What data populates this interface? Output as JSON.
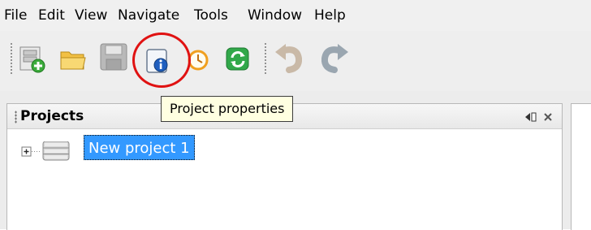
{
  "menubar": {
    "items": [
      "File",
      "Edit",
      "View",
      "Navigate",
      "Tools",
      "Window",
      "Help"
    ]
  },
  "toolbar": {
    "buttons": [
      {
        "icon": "new-project-icon",
        "enabled": true
      },
      {
        "icon": "open-folder-icon",
        "enabled": true
      },
      {
        "icon": "save-icon",
        "enabled": false
      },
      {
        "icon": "project-properties-icon",
        "enabled": true
      },
      {
        "icon": "clock-icon",
        "enabled": true
      },
      {
        "icon": "refresh-icon",
        "enabled": true
      },
      {
        "icon": "undo-icon",
        "enabled": false
      },
      {
        "icon": "redo-icon",
        "enabled": false
      }
    ],
    "highlight_color": "#e01212"
  },
  "tooltip": {
    "text": "Project properties"
  },
  "projects_panel": {
    "title": "Projects",
    "tree": [
      {
        "label": "New project 1",
        "selected": true,
        "expanded": false
      }
    ]
  },
  "colors": {
    "selection": "#3399ff",
    "tooltip_bg": "#ffffe1"
  }
}
